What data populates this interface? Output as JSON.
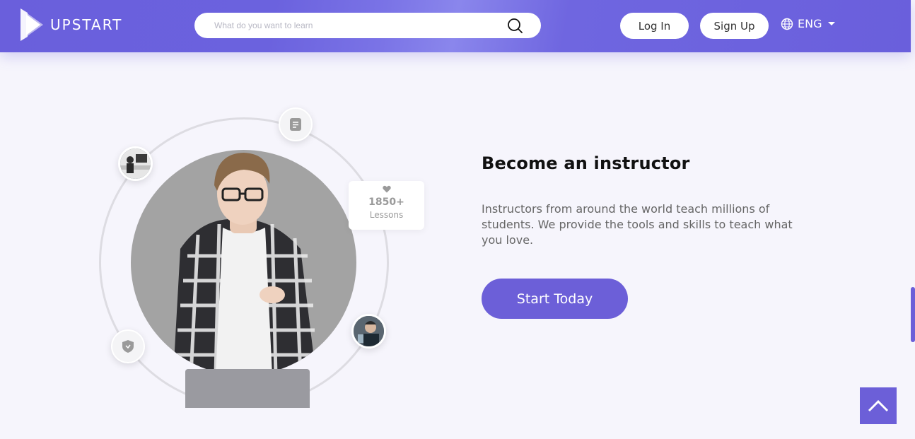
{
  "header": {
    "brand": "UPSTART",
    "search_placeholder": "What do you want to learn",
    "login_label": "Log In",
    "signup_label": "Sign Up",
    "language": "ENG"
  },
  "hero": {
    "title": "Become an instructor",
    "description": "Instructors from around the world teach millions of students. We provide the tools and skills to teach what you love.",
    "cta_label": "Start Today",
    "lessons_count": "1850+",
    "lessons_label": "Lessons"
  },
  "colors": {
    "accent": "#6c5fd8",
    "header": "#6a5fdc",
    "background": "#f6f5fc"
  },
  "icons": {
    "logo": "play-logo-icon",
    "search": "search-icon",
    "language": "globe-icon",
    "caret": "caret-down-icon",
    "lessons": "heart-icon",
    "document": "document-icon",
    "shield": "shield-icon",
    "scroll_top": "chevron-up-icon"
  }
}
